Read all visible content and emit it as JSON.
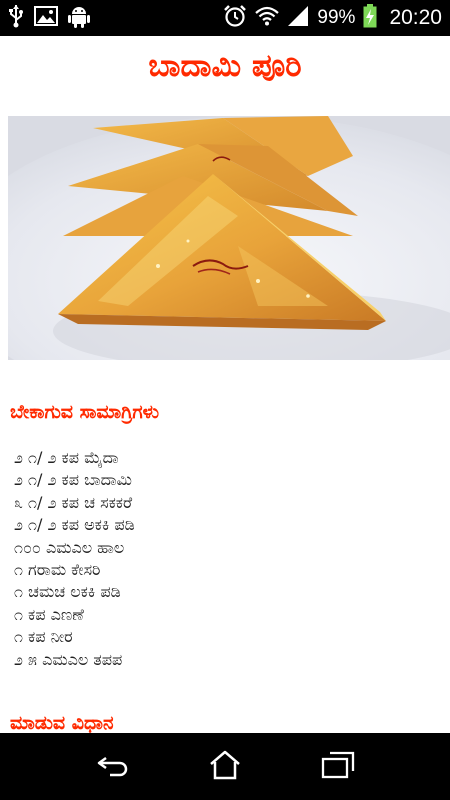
{
  "status_bar": {
    "battery_percent": "99%",
    "time": "20:20",
    "icons": [
      "usb-icon",
      "image-icon",
      "android-icon",
      "alarm-icon",
      "wifi-icon",
      "signal-icon",
      "battery-charging-icon"
    ]
  },
  "page": {
    "title": "ಬಾದಾಮಿ ಪೂರಿ",
    "hero_image": "food-photo"
  },
  "ingredients": {
    "heading": "ಬೇಕಾಗುವ ಸಾಮಾಗ್ರಿಗಳು",
    "items": [
      "೨ ೧/ ೨ ಕಪ ಮೈದಾ",
      "೨ ೧/ ೨ ಕಪ ಬಾದಾಮಿ",
      "೩ ೧/ ೨ ಕಪ ಚ ಸಕಕರೆ",
      "೨ ೧/ ೨ ಕಪ ಅಕಕಿ ಪಡಿ",
      "೧೦೦ ಎಮಎಲ ಹಾಲ",
      "೧ ಗರಾಮ ಕೇಸರಿ",
      "೧ ಚಮಚ ಲಕಕಿ ಪಡಿ",
      "೧ ಕಪ ಎಣಣೆ",
      "೧  ಕಪ ನೀರ",
      "೨ ೫  ಎಮಎಲ ತಪಪ"
    ]
  },
  "method": {
    "heading": "ಮಾಡುವ ವಿಧಾನ"
  },
  "nav_bar": {
    "buttons": [
      "back-icon",
      "home-icon",
      "recent-apps-icon"
    ]
  },
  "colors": {
    "accent": "#ff2a00",
    "status_bar_bg": "#000000",
    "nav_bar_bg": "#000000",
    "battery_green": "#7ed957"
  }
}
